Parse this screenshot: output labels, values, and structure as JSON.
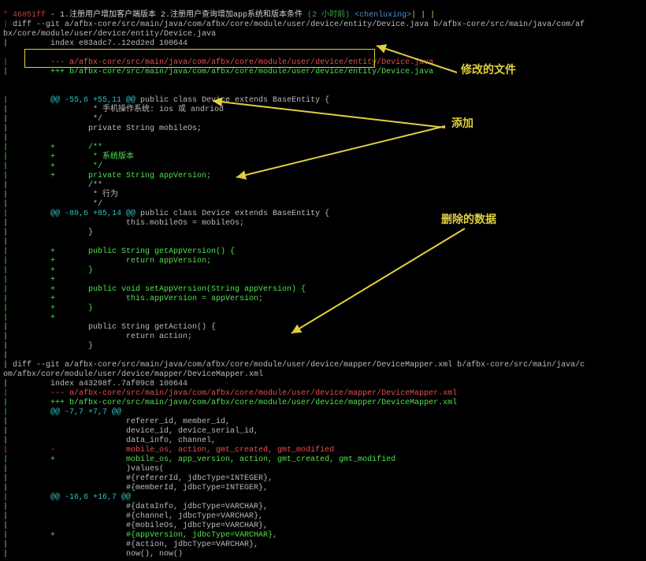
{
  "commit": {
    "graph_prefix": "* ",
    "hash": "46051ff",
    "sep": " - ",
    "subject": "1.注册用户增加客户端版本 2.注册用户查询增加app系统和版本条件",
    "time": " (2 小时前)",
    "author": " <chenluxing>"
  },
  "diffs": [
    {
      "cmd_prefix": "| ",
      "cmd": "diff --git a/afbx-core/src/main/java/com/afbx/core/module/user/device/entity/Device.java b/afbx-core/src/main/java/com/af",
      "cmd2_prefix": "bx/core/module/user/device/entity/Device.java",
      "index": "|         index e83adc7..12ed2ed 100644",
      "minus": "|         --- a/afbx-core/src/main/java/com/afbx/core/module/user/device/entity/Device.java",
      "plus": "|         +++ b/afbx-core/src/main/java/com/afbx/core/module/user/device/entity/Device.java",
      "hunks": [
        {
          "header": "|         @@ -55,6 +55,11 @@ public class Device extends BaseEntity {",
          "header_pre": "@@ -55,6 +55,11 @@",
          "header_ctx": " public class Device extends BaseEntity {",
          "lines": [
            {
              "t": "ctx",
              "s": "|                  * 手机操作系统: ios 或 andriod"
            },
            {
              "t": "ctx",
              "s": "|                  */"
            },
            {
              "t": "ctx",
              "s": "|                 private String mobileOs;"
            },
            {
              "t": "ctx",
              "s": "| "
            },
            {
              "t": "add",
              "s": "|         +       /**"
            },
            {
              "t": "add",
              "s": "|         +        * 系统版本"
            },
            {
              "t": "add",
              "s": "|         +        */"
            },
            {
              "t": "add",
              "s": "|         +       private String appVersion;"
            },
            {
              "t": "ctx",
              "s": "|                 /**"
            },
            {
              "t": "ctx",
              "s": "|                  * 行为"
            },
            {
              "t": "ctx",
              "s": "|                  */"
            }
          ]
        },
        {
          "header_pre": "@@ -80,6 +85,14 @@",
          "header_ctx": " public class Device extends BaseEntity {",
          "lines": [
            {
              "t": "ctx",
              "s": "|                         this.mobileOs = mobileOs;"
            },
            {
              "t": "ctx",
              "s": "|                 }"
            },
            {
              "t": "ctx",
              "s": "| "
            },
            {
              "t": "add",
              "s": "|         +       public String getAppVersion() {"
            },
            {
              "t": "add",
              "s": "|         +               return appVersion;"
            },
            {
              "t": "add",
              "s": "|         +       }"
            },
            {
              "t": "add",
              "s": "|         +"
            },
            {
              "t": "add",
              "s": "|         +       public void setAppVersion(String appVersion) {"
            },
            {
              "t": "add",
              "s": "|         +               this.appVersion = appVersion;"
            },
            {
              "t": "add",
              "s": "|         +       }"
            },
            {
              "t": "add",
              "s": "|         +"
            },
            {
              "t": "ctx",
              "s": "|                 public String getAction() {"
            },
            {
              "t": "ctx",
              "s": "|                         return action;"
            },
            {
              "t": "ctx",
              "s": "|                 }"
            }
          ]
        }
      ]
    },
    {
      "cmd": "| diff --git a/afbx-core/src/main/java/com/afbx/core/module/user/device/mapper/DeviceMapper.xml b/afbx-core/src/main/java/c",
      "cmd2": "om/afbx/core/module/user/device/mapper/DeviceMapper.xml",
      "index": "|         index a43298f..7af09c8 100644",
      "minus": "|         --- a/afbx-core/src/main/java/com/afbx/core/module/user/device/mapper/DeviceMapper.xml",
      "plus": "|         +++ b/afbx-core/src/main/java/com/afbx/core/module/user/device/mapper/DeviceMapper.xml",
      "hunks": [
        {
          "header_pre": "@@ -7,7 +7,7 @@",
          "header_ctx": "",
          "lines": [
            {
              "t": "ctx",
              "s": "|                         referer_id, member_id,"
            },
            {
              "t": "ctx",
              "s": "|                         device_id, device_serial_id,"
            },
            {
              "t": "ctx",
              "s": "|                         data_info, channel,"
            },
            {
              "t": "del",
              "s": "|         -               mobile_os, action, gmt_created, gmt_modified"
            },
            {
              "t": "add",
              "s": "|         +               mobile_os, app_version, action, gmt_created, gmt_modified"
            },
            {
              "t": "ctx",
              "s": "|                         )values("
            },
            {
              "t": "ctx",
              "s": "|                         #{refererId, jdbcType=INTEGER},"
            },
            {
              "t": "ctx",
              "s": "|                         #{memberId, jdbcType=INTEGER},"
            }
          ]
        },
        {
          "header_pre": "@@ -16,6 +16,7 @@",
          "header_ctx": "",
          "lines": [
            {
              "t": "ctx",
              "s": "|                         #{dataInfo, jdbcType=VARCHAR},"
            },
            {
              "t": "ctx",
              "s": "|                         #{channel, jdbcType=VARCHAR},"
            },
            {
              "t": "ctx",
              "s": "|                         #{mobileOs, jdbcType=VARCHAR},"
            },
            {
              "t": "add",
              "s": "|         +               #{appVersion, jdbcType=VARCHAR},"
            },
            {
              "t": "ctx",
              "s": "|                         #{action, jdbcType=VARCHAR},"
            },
            {
              "t": "ctx",
              "s": "|                         now(), now()"
            }
          ]
        }
      ]
    }
  ],
  "annotations": {
    "modified_file": "修改的文件",
    "added": "添加",
    "deleted": "删除的数据"
  }
}
